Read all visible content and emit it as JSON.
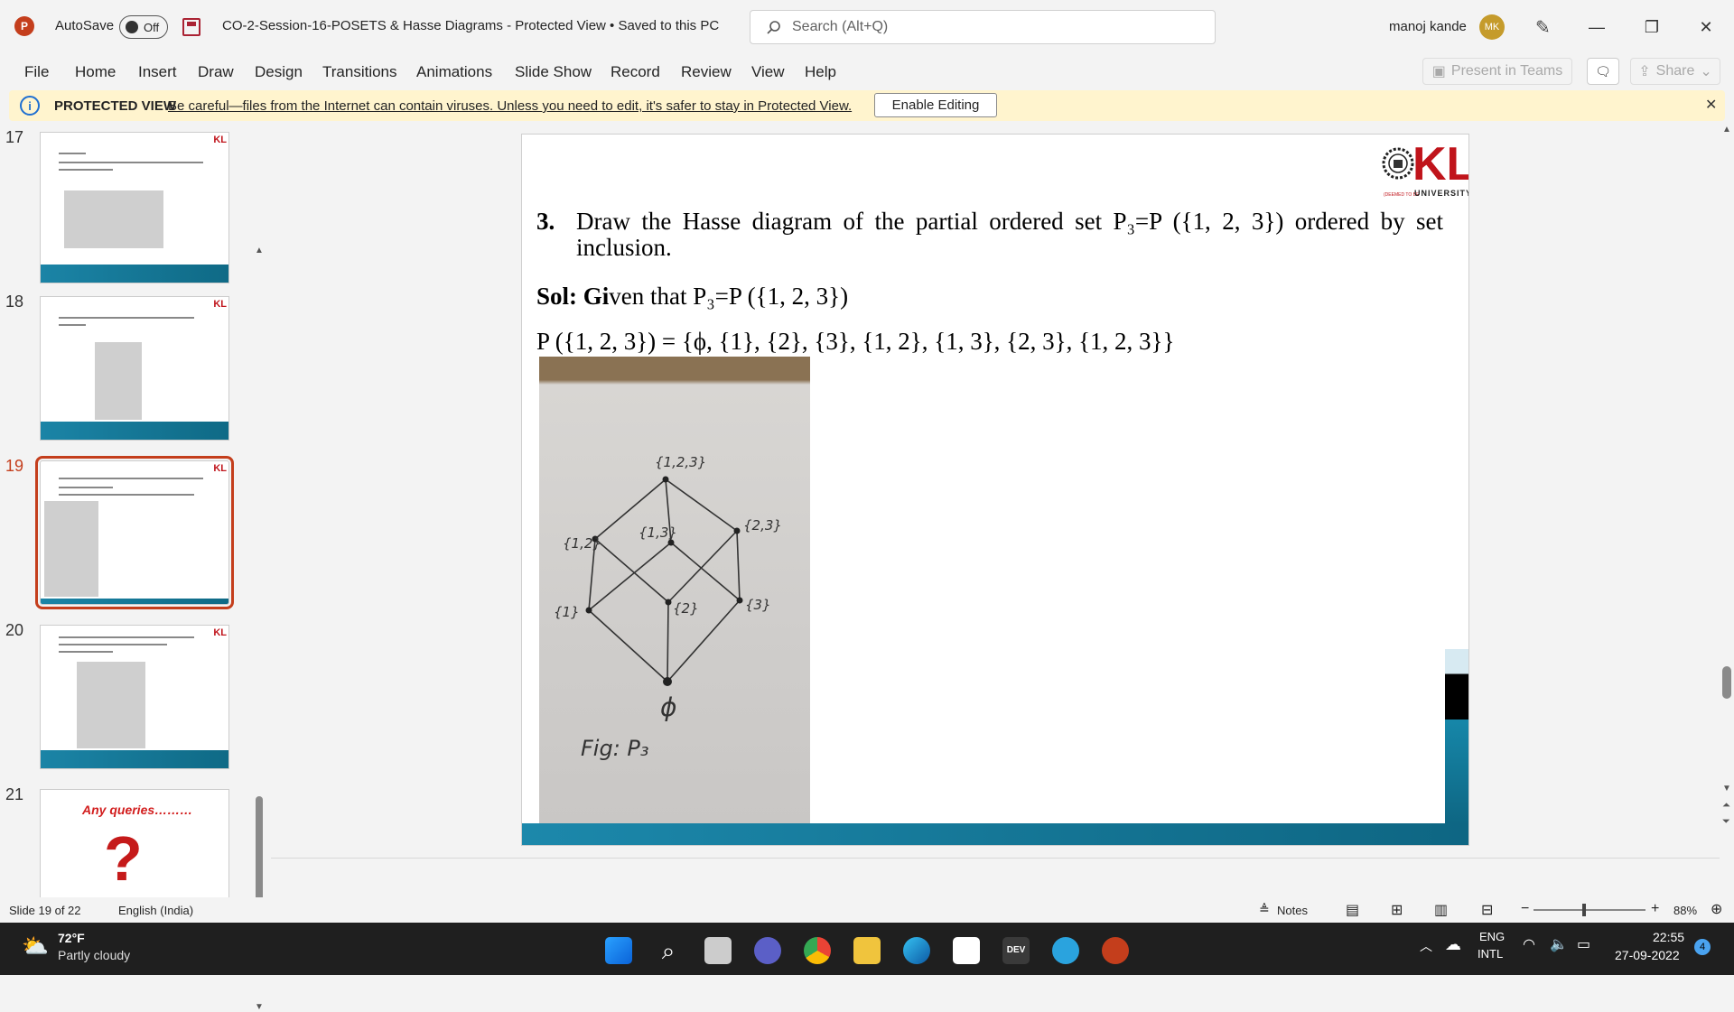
{
  "titlebar": {
    "autosave_label": "AutoSave",
    "autosave_state": "Off",
    "document_title": "CO-2-Session-16-POSETS & Hasse Diagrams  -  Protected View • Saved to this PC",
    "search_placeholder": "Search (Alt+Q)",
    "user_name": "manoj kande",
    "user_initials": "MK"
  },
  "menu": {
    "items": [
      "File",
      "Home",
      "Insert",
      "Draw",
      "Design",
      "Transitions",
      "Animations",
      "Slide Show",
      "Record",
      "Review",
      "View",
      "Help"
    ],
    "present_label": "Present in Teams",
    "share_label": "Share"
  },
  "protected_view": {
    "label": "PROTECTED VIEW",
    "message": "Be careful—files from the Internet can contain viruses. Unless you need to edit, it's safer to stay in Protected View.",
    "enable_label": "Enable Editing"
  },
  "thumbnails": {
    "numbers": [
      "17",
      "18",
      "19",
      "20",
      "21"
    ],
    "slide21_title": "Any queries………"
  },
  "slide": {
    "logo_text": "KL",
    "logo_sub": "UNIVERSITY",
    "logo_deemed": "(DEEMED TO BE",
    "question_number": "3.",
    "question_text": "Draw the Hasse diagram of the partial ordered set P₃=P ({1, 2, 3}) ordered by set inclusion.",
    "sol_label": "Sol: Gi",
    "sol_text": "ven that P₃=P ({1, 2, 3})",
    "power_set": "P ({1, 2, 3}) = {ϕ, {1}, {2}, {3}, {1, 2}, {1, 3}, {2, 3}, {1, 2, 3}}",
    "diagram": {
      "top": "{1,2,3}",
      "n12": "{1,2}",
      "n13": "{1,3}",
      "n23": "{2,3}",
      "n1": "{1}",
      "n2": "{2}",
      "n3": "{3}",
      "bottom": "ϕ",
      "caption": "Fig: P₃"
    }
  },
  "statusbar": {
    "slide_info": "Slide 19 of 22",
    "language": "English (India)",
    "notes_label": "Notes",
    "zoom": "88%"
  },
  "taskbar": {
    "temp": "72°F",
    "weather": "Partly cloudy",
    "lang1": "ENG",
    "lang2": "INTL",
    "time": "22:55",
    "date": "27-09-2022",
    "notif_count": "4"
  },
  "colors": {
    "accent": "#c43e1c",
    "band": "#1687a9",
    "banner": "#fff4ce",
    "kl_red": "#c0141b"
  }
}
